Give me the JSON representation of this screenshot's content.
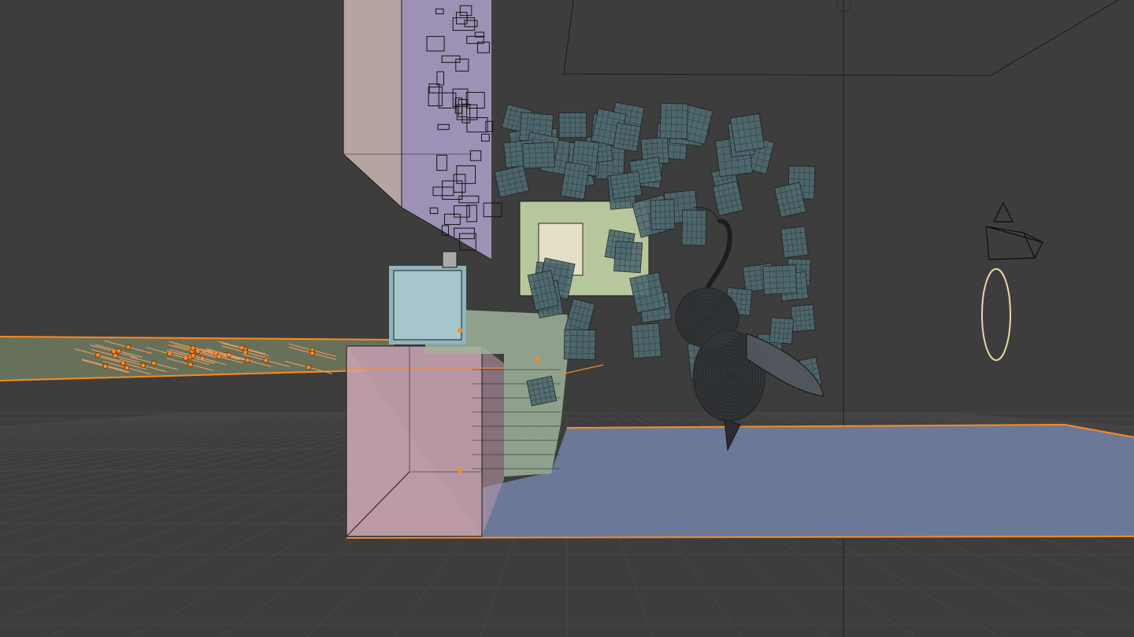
{
  "viewport": {
    "mode": "wireframe-xray",
    "background": "#3d3d3d",
    "grid_color": "#4a4a4a",
    "selection_color": "#ff8a1c"
  },
  "scene_objects": [
    {
      "name": "left-floor-strip",
      "selected": true,
      "color": "#6f7a5e"
    },
    {
      "name": "scatter-orange-points",
      "selected": true,
      "color": "#ff8a1c"
    },
    {
      "name": "tall-cabinet",
      "selected": false,
      "color": "#b8a3a3"
    },
    {
      "name": "hanging-cluster",
      "selected": false,
      "color": "#a79ac2"
    },
    {
      "name": "lower-cabinet",
      "selected": false,
      "color": "#c7a3ae"
    },
    {
      "name": "shelf-green",
      "selected": false,
      "color": "#9db39a"
    },
    {
      "name": "tv-screen",
      "selected": false,
      "color": "#8fb4bd"
    },
    {
      "name": "corkboard-frame",
      "selected": false,
      "color": "#b7c79c"
    },
    {
      "name": "paper-notes",
      "selected": false,
      "color": "#4f6a70"
    },
    {
      "name": "bee-model",
      "selected": false,
      "color": "#2b2d2f"
    },
    {
      "name": "blue-floor-plane",
      "selected": true,
      "color": "#6b7898"
    },
    {
      "name": "camera",
      "selected": false,
      "color": "#0d0d0d"
    },
    {
      "name": "area-light-ring",
      "selected": false,
      "color": "#e9d7a4"
    }
  ]
}
